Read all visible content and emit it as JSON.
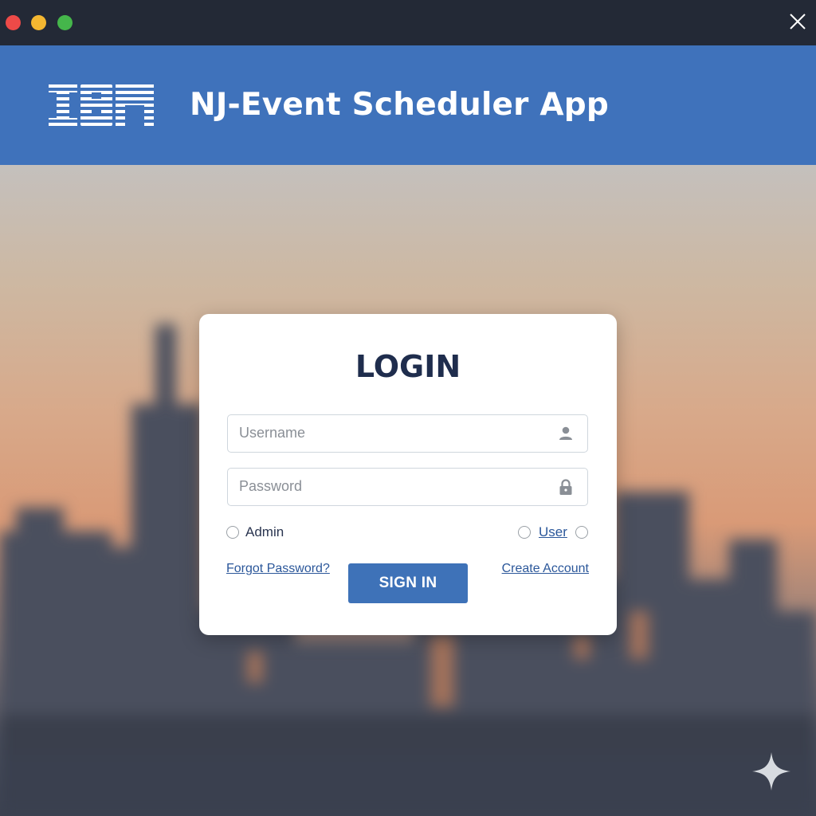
{
  "window": {
    "controls": [
      "close-dot",
      "minimize-dot",
      "maximize-dot"
    ],
    "close_icon": "close-icon"
  },
  "header": {
    "logo_text": "IBM",
    "title": "NJ-Event Scheduler App",
    "background_color": "#3f72bb"
  },
  "login": {
    "title": "LOGIN",
    "username": {
      "placeholder": "Username",
      "value": "",
      "icon": "user-icon"
    },
    "password": {
      "placeholder": "Password",
      "value": "",
      "icon": "lock-icon"
    },
    "roles": [
      {
        "label": "Admin",
        "selected": false
      },
      {
        "label": "User",
        "selected": false
      }
    ],
    "forgot_password": "Forgot Password?",
    "sign_in": "SIGN IN",
    "create_account": "Create Account",
    "accent_color": "#3e72b8"
  },
  "decor": {
    "corner_icon": "sparkle-icon"
  }
}
